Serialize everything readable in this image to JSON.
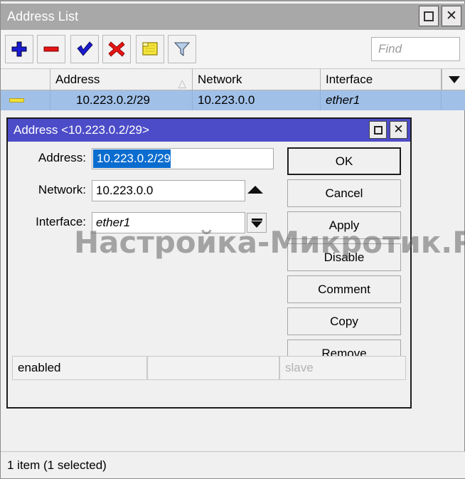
{
  "window": {
    "title": "Address List",
    "controls": {
      "restore": "restore-icon",
      "close": "close-icon"
    }
  },
  "toolbar": {
    "buttons": [
      {
        "name": "add",
        "icon": "plus-icon",
        "color": "#1414c8"
      },
      {
        "name": "remove",
        "icon": "minus-icon",
        "color": "#e81414"
      },
      {
        "name": "enable",
        "icon": "check-icon",
        "color": "#1414c8"
      },
      {
        "name": "disable",
        "icon": "cross-icon",
        "color": "#e81414"
      },
      {
        "name": "comment",
        "icon": "note-icon",
        "color": "#f2e03a"
      },
      {
        "name": "filter",
        "icon": "funnel-icon",
        "color": "#9db9dd"
      }
    ],
    "find_placeholder": "Find",
    "find_value": ""
  },
  "table": {
    "columns": [
      "",
      "Address",
      "Network",
      "Interface"
    ],
    "sort_column": "Address",
    "sort_indicator": "△",
    "rows": [
      {
        "flag": "",
        "address": "10.223.0.2/29",
        "network": "10.223.0.0",
        "interface": "ether1",
        "selected": true
      }
    ]
  },
  "dialog": {
    "title": "Address <10.223.0.2/29>",
    "controls": {
      "restore": "restore-icon",
      "close": "close-icon"
    },
    "fields": [
      {
        "label": "Address:",
        "value": "10.223.0.2/29",
        "selected": true,
        "italic": false
      },
      {
        "label": "Network:",
        "value": "10.223.0.0",
        "selected": false,
        "italic": false
      },
      {
        "label": "Interface:",
        "value": "ether1",
        "selected": false,
        "italic": true
      }
    ],
    "buttons": [
      {
        "label": "OK",
        "default": true
      },
      {
        "label": "Cancel",
        "default": false
      },
      {
        "label": "Apply",
        "default": false
      },
      {
        "label": "Disable",
        "default": false
      },
      {
        "label": "Comment",
        "default": false
      },
      {
        "label": "Copy",
        "default": false
      },
      {
        "label": "Remove",
        "default": false
      }
    ],
    "status": [
      {
        "text": "enabled",
        "dim": false
      },
      {
        "text": "",
        "dim": false
      },
      {
        "text": "slave",
        "dim": true
      }
    ]
  },
  "watermark": "Настройка-Микротик.РФ",
  "bottom_status": "1 item (1 selected)",
  "colors": {
    "title_bar": "#a8a8a8",
    "dialog_title_bar": "#4c4cc8",
    "row_selected": "#a0c0e8",
    "text_selection": "#0a6ccf"
  }
}
